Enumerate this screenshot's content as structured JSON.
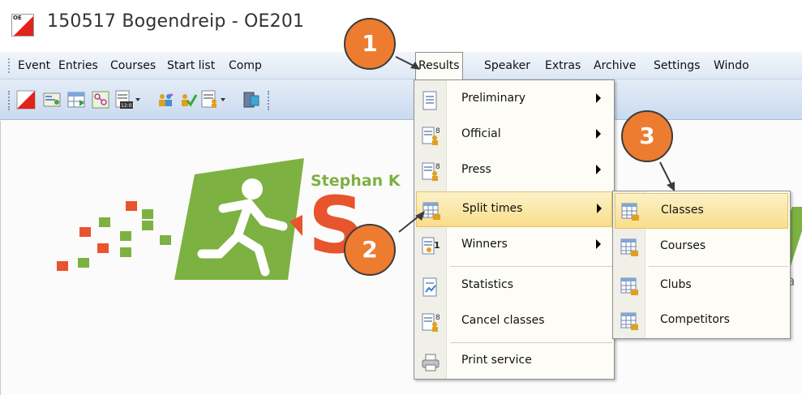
{
  "window": {
    "title": "150517 Bogendreip  -  OE201"
  },
  "menubar": {
    "items": [
      {
        "label": "Event"
      },
      {
        "label": "Entries"
      },
      {
        "label": "Courses"
      },
      {
        "label": "Start list"
      },
      {
        "label": "Comp"
      },
      {
        "label": "Results"
      },
      {
        "label": "Speaker"
      },
      {
        "label": "Extras"
      },
      {
        "label": "Archive"
      },
      {
        "label": "Settings"
      },
      {
        "label": "Windo"
      }
    ]
  },
  "content": {
    "logo_small_text": "Stephan K",
    "logo_big_text": "S",
    "logo_fragment_text": "a"
  },
  "results_menu": {
    "items": [
      {
        "label": "Preliminary",
        "icon": "document-icon"
      },
      {
        "label": "Official",
        "icon": "document-user-icon"
      },
      {
        "label": "Press",
        "icon": "document-user-icon"
      },
      {
        "label": "Split times",
        "icon": "table-icon"
      },
      {
        "label": "Winners",
        "icon": "document-one-icon"
      },
      {
        "label": "Statistics",
        "icon": "document-chart-icon"
      },
      {
        "label": "Cancel classes",
        "icon": "document-user-icon"
      },
      {
        "label": "Print service",
        "icon": "printer-icon"
      }
    ]
  },
  "split_times_submenu": {
    "items": [
      {
        "label": "Classes"
      },
      {
        "label": "Courses"
      },
      {
        "label": "Clubs"
      },
      {
        "label": "Competitors"
      }
    ]
  },
  "callouts": {
    "one": "1",
    "two": "2",
    "three": "3"
  },
  "colors": {
    "callout_fill": "#ed7b30",
    "highlight": "#f8de8a",
    "logo_green": "#7db142",
    "logo_orange": "#e8542d",
    "brand_red": "#e2231a"
  }
}
